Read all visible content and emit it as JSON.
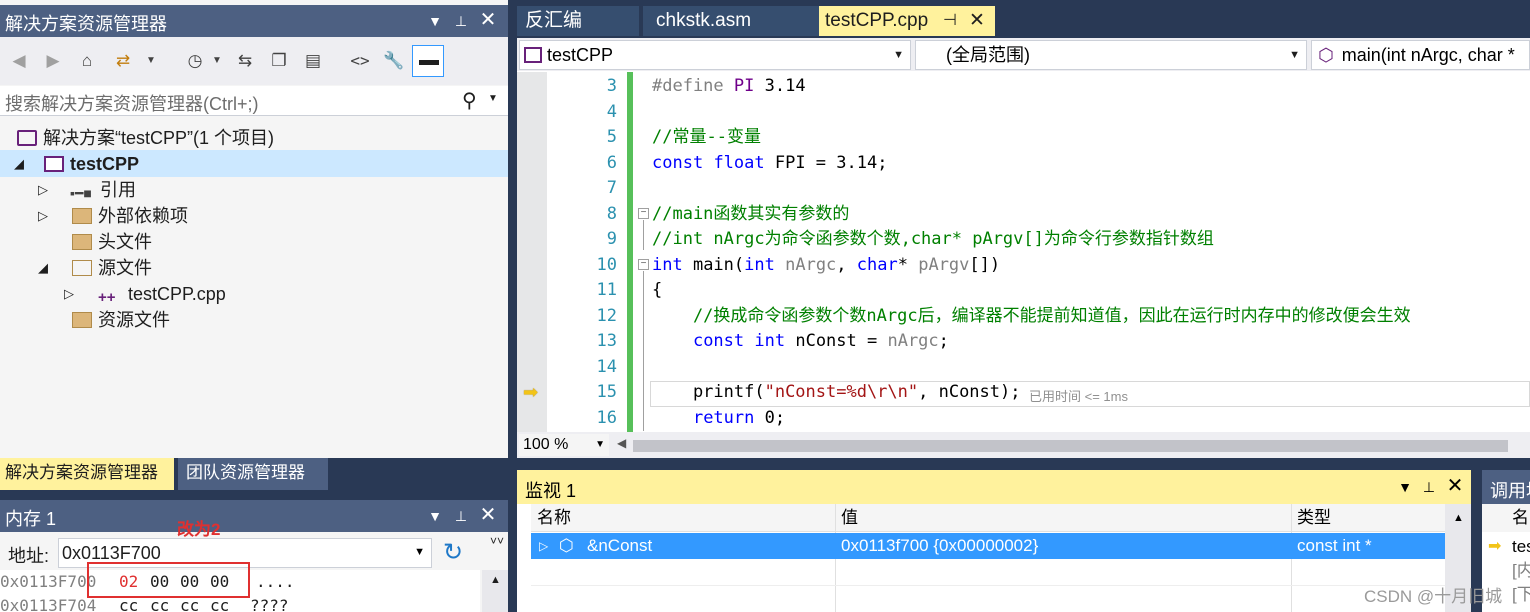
{
  "solution_explorer": {
    "title": "解决方案资源管理器",
    "search_placeholder": "搜索解决方案资源管理器(Ctrl+;)",
    "tree": {
      "solution": "解决方案“testCPP”(1 个项目)",
      "project": "testCPP",
      "references": "引用",
      "external_deps": "外部依赖项",
      "header_files": "头文件",
      "source_files": "源文件",
      "source_file_cpp": "testCPP.cpp",
      "resource_files": "资源文件"
    },
    "bottom_tabs": [
      "解决方案资源管理器",
      "团队资源管理器"
    ]
  },
  "editor": {
    "tabs": [
      "反汇编",
      "chkstk.asm",
      "testCPP.cpp"
    ],
    "active_tab": "testCPP.cpp",
    "project_combo": "testCPP",
    "scope_combo": "(全局范围)",
    "function_combo": "main(int nArgc, char *",
    "zoom": "100 %",
    "elapsed_hint": "已用时间 <= 1ms",
    "lines": [
      {
        "n": "3",
        "parts": [
          [
            "pp",
            "#define "
          ],
          [
            "mac",
            "PI"
          ],
          [
            "",
            " 3.14"
          ]
        ]
      },
      {
        "n": "4",
        "parts": []
      },
      {
        "n": "5",
        "parts": [
          [
            "cm",
            "//常量--变量"
          ]
        ]
      },
      {
        "n": "6",
        "parts": [
          [
            "kw",
            "const"
          ],
          [
            "",
            " "
          ],
          [
            "kw",
            "float"
          ],
          [
            "",
            " FPI = 3.14;"
          ]
        ]
      },
      {
        "n": "7",
        "parts": []
      },
      {
        "n": "8",
        "parts": [
          [
            "cm",
            "//main函数其实有参数的"
          ]
        ]
      },
      {
        "n": "9",
        "parts": [
          [
            "cm",
            "//int nArgc为命令函参数个数,char* pArgv[]为命令行参数指针数组"
          ]
        ]
      },
      {
        "n": "10",
        "parts": [
          [
            "kw",
            "int"
          ],
          [
            "",
            " main("
          ],
          [
            "kw",
            "int"
          ],
          [
            "",
            " "
          ],
          [
            "pm",
            "nArgc"
          ],
          [
            "",
            ", "
          ],
          [
            "kw",
            "char"
          ],
          [
            "",
            "* "
          ],
          [
            "pm",
            "pArgv"
          ],
          [
            "",
            "[])"
          ]
        ]
      },
      {
        "n": "11",
        "parts": [
          [
            "",
            "{"
          ]
        ]
      },
      {
        "n": "12",
        "parts": [
          [
            "cm",
            "    //换成命令函参数个数nArgc后，编译器不能提前知道值，因此在运行时内存中的修改便会生效"
          ]
        ]
      },
      {
        "n": "13",
        "parts": [
          [
            "",
            "    "
          ],
          [
            "kw",
            "const"
          ],
          [
            "",
            " "
          ],
          [
            "kw",
            "int"
          ],
          [
            "",
            " nConst = "
          ],
          [
            "pm",
            "nArgc"
          ],
          [
            "",
            ";"
          ]
        ]
      },
      {
        "n": "14",
        "parts": []
      },
      {
        "n": "15",
        "parts": [
          [
            "",
            "    printf("
          ],
          [
            "st",
            "\"nConst=%d\\r\\n\""
          ],
          [
            "",
            ", nConst);"
          ]
        ]
      },
      {
        "n": "16",
        "parts": [
          [
            "",
            "    "
          ],
          [
            "kw",
            "return"
          ],
          [
            "",
            " 0;"
          ]
        ]
      }
    ]
  },
  "watch": {
    "title": "监视 1",
    "headers": [
      "名称",
      "值",
      "类型"
    ],
    "rows": [
      {
        "name": "&nConst",
        "value": "0x0113f700 {0x00000002}",
        "type": "const int *"
      }
    ]
  },
  "callstack": {
    "title": "调用堆",
    "header": "名",
    "rows": [
      "tes",
      "[内",
      "[下"
    ]
  },
  "memory": {
    "title": "内存 1",
    "annotation": "改为2",
    "address_label": "地址:",
    "address_value": "0x0113F700",
    "rows": [
      {
        "addr": "0x0113F700",
        "bytes": [
          "02",
          "00",
          "00",
          "00"
        ],
        "ascii": "...."
      },
      {
        "addr": "0x0113F704",
        "bytes": [
          "cc",
          "cc",
          "cc",
          "cc"
        ],
        "ascii": "????"
      }
    ]
  },
  "watermark": "CSDN @十月旧城",
  "colors": {
    "accent_blue": "#007acc",
    "selected_row": "#3399ff",
    "tool_title_blue": "#4d6082",
    "tool_title_yellow": "#fff29d",
    "annotation_red": "#e03030"
  }
}
